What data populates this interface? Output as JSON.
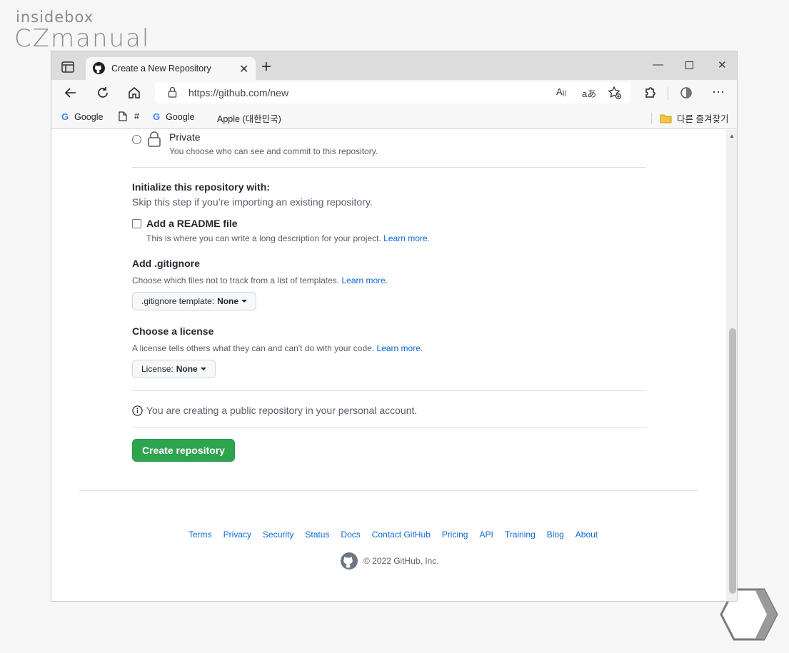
{
  "watermark": {
    "top": "insidebox",
    "main": "CZmanual"
  },
  "browser": {
    "tab_title": "Create a New Repository",
    "url": "https://github.com/new",
    "bookmarks": [
      {
        "label": "Google",
        "icon": "google-icon"
      },
      {
        "label": "#",
        "icon": "page-icon"
      },
      {
        "label": "Google",
        "icon": "google-icon"
      },
      {
        "label": "Apple (대한민국)",
        "icon": "apple-icon"
      }
    ],
    "other_bookmarks": "다른 즐겨찾기",
    "new_tab": "+",
    "close_tab": "✕"
  },
  "visibility": {
    "private_label": "Private",
    "private_desc": "You choose who can see and commit to this repository."
  },
  "initialize": {
    "title": "Initialize this repository with:",
    "subtitle": "Skip this step if you’re importing an existing repository.",
    "readme_label": "Add a README file",
    "readme_desc": "This is where you can write a long description for your project.",
    "readme_link": "Learn more."
  },
  "gitignore": {
    "title": "Add .gitignore",
    "desc": "Choose which files not to track from a list of templates.",
    "link": "Learn more.",
    "button_prefix": ".gitignore template:",
    "button_value": "None"
  },
  "license": {
    "title": "Choose a license",
    "desc": "A license tells others what they can and can't do with your code.",
    "link": "Learn more.",
    "button_prefix": "License:",
    "button_value": "None"
  },
  "notice": "You are creating a public repository in your personal account.",
  "create_button": "Create repository",
  "footer": {
    "links": [
      "Terms",
      "Privacy",
      "Security",
      "Status",
      "Docs",
      "Contact GitHub",
      "Pricing",
      "API",
      "Training",
      "Blog",
      "About"
    ],
    "copyright": "© 2022 GitHub, Inc."
  },
  "colors": {
    "primary_green": "#2da44e",
    "link_blue": "#0969da"
  }
}
